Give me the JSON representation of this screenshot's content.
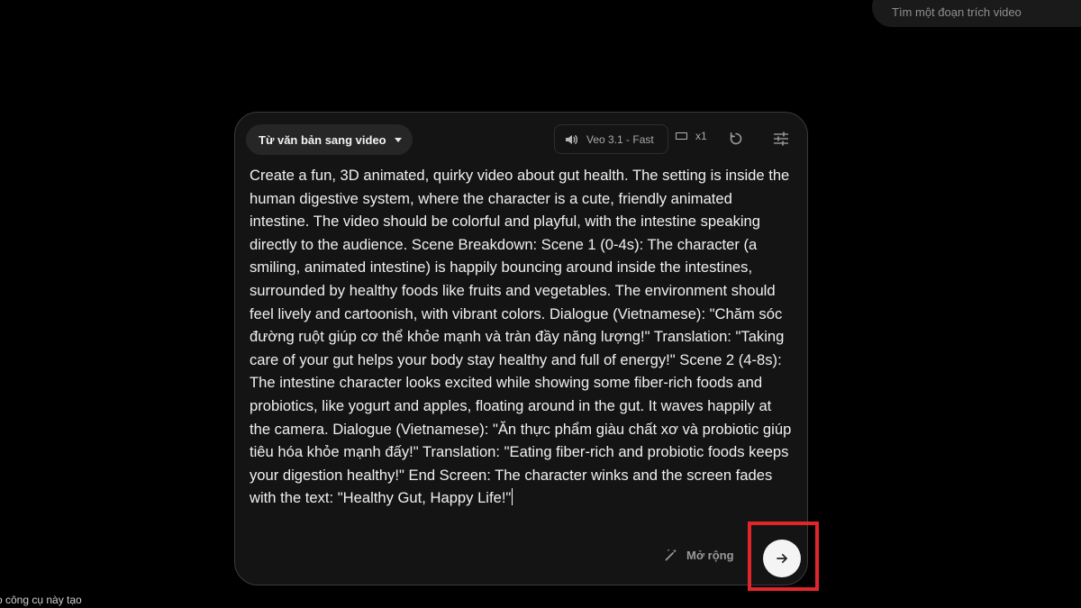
{
  "search": {
    "placeholder": "Tìm một đoạn trích video"
  },
  "footer": {
    "note": "o công cụ này tạo"
  },
  "composer": {
    "mode_label": "Từ văn bản sang video",
    "model_label": "Veo 3.1 - Fast",
    "output_count": "x1",
    "prompt": "Create a fun, 3D animated, quirky video about gut health. The setting is inside the human digestive system, where the character is a cute, friendly animated intestine. The video should be colorful and playful, with the intestine speaking directly to the audience. Scene Breakdown: Scene 1 (0-4s): The character (a smiling, animated intestine) is happily bouncing around inside the intestines, surrounded by healthy foods like fruits and vegetables. The environment should feel lively and cartoonish, with vibrant colors. Dialogue (Vietnamese): \"Chăm sóc đường ruột giúp cơ thể khỏe mạnh và tràn đầy năng lượng!\" Translation: \"Taking care of your gut helps your body stay healthy and full of energy!\" Scene 2 (4-8s): The intestine character looks excited while showing some fiber-rich foods and probiotics, like yogurt and apples, floating around in the gut. It waves happily at the camera. Dialogue (Vietnamese): \"Ăn thực phẩm giàu chất xơ và probiotic giúp tiêu hóa khỏe mạnh đấy!\" Translation: \"Eating fiber-rich and probiotic foods keeps your digestion healthy!\" End Screen: The character winks and the screen fades with the text: \"Healthy Gut, Happy Life!\"",
    "expand_label": "Mở rộng"
  },
  "icons": {
    "volume": "volume-icon",
    "aspect": "aspect-ratio-icon",
    "reset": "refresh-icon",
    "settings": "sliders-icon",
    "expand": "magic-wand-icon",
    "send": "arrow-right-icon"
  },
  "colors": {
    "background": "#000000",
    "card": "#141414",
    "highlight": "#e0262b",
    "send_button": "#f4f4f4"
  }
}
